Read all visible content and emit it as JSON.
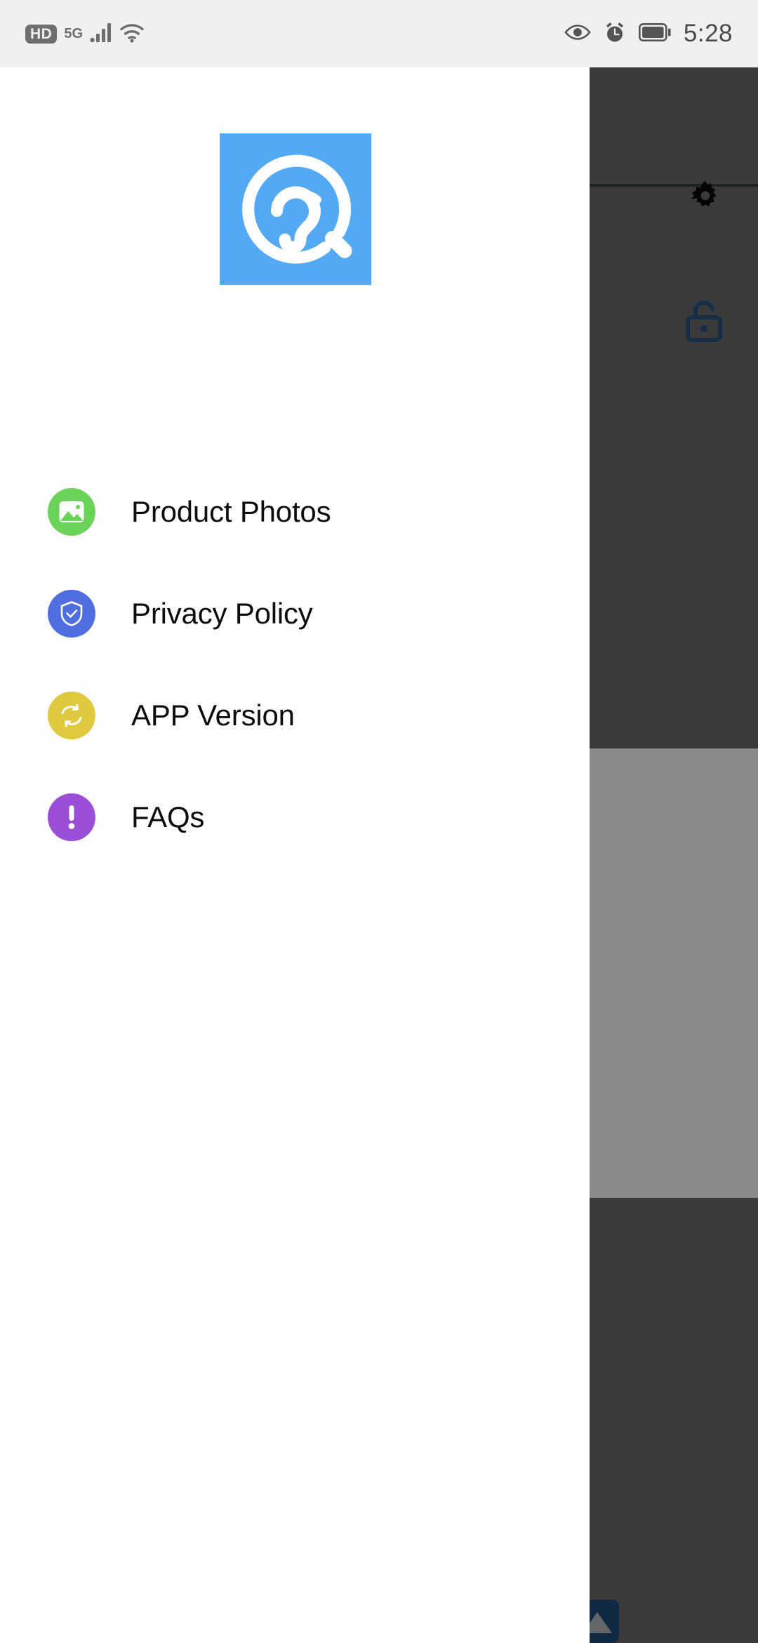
{
  "status_bar": {
    "time": "5:28",
    "hd_label": "HD",
    "network_label": "5G",
    "icons": {
      "hd": "hd-badge-icon",
      "network": "5g-label-icon",
      "signal": "signal-bars-icon",
      "wifi": "wifi-icon",
      "eye": "eye-icon",
      "alarm": "alarm-clock-icon",
      "battery": "battery-icon"
    }
  },
  "drawer": {
    "logo": {
      "name": "app-logo",
      "icon": "ear-hearing-icon",
      "background_color": "#54a9f5",
      "glyph_color": "#ffffff"
    },
    "menu_items": [
      {
        "label": "Product Photos",
        "icon": "image-icon",
        "color": "#6bd35a",
        "name": "product-photos"
      },
      {
        "label": "Privacy Policy",
        "icon": "shield-check-icon",
        "color": "#4f6fe0",
        "name": "privacy-policy"
      },
      {
        "label": "APP Version",
        "icon": "refresh-sync-icon",
        "color": "#dfc93f",
        "name": "app-version"
      },
      {
        "label": "FAQs",
        "icon": "exclamation-icon",
        "color": "#9b4fd8",
        "name": "faqs"
      }
    ]
  },
  "background_app": {
    "scrim_color": "#606060",
    "gear_icon": "gear-settings-icon",
    "lock_icon": "unlock-padlock-icon",
    "lock_color": "#2b5584",
    "fab_icon": "triangle-up-icon",
    "fab_color": "#1f4f7d",
    "dark_card_color": "#3b4542"
  }
}
